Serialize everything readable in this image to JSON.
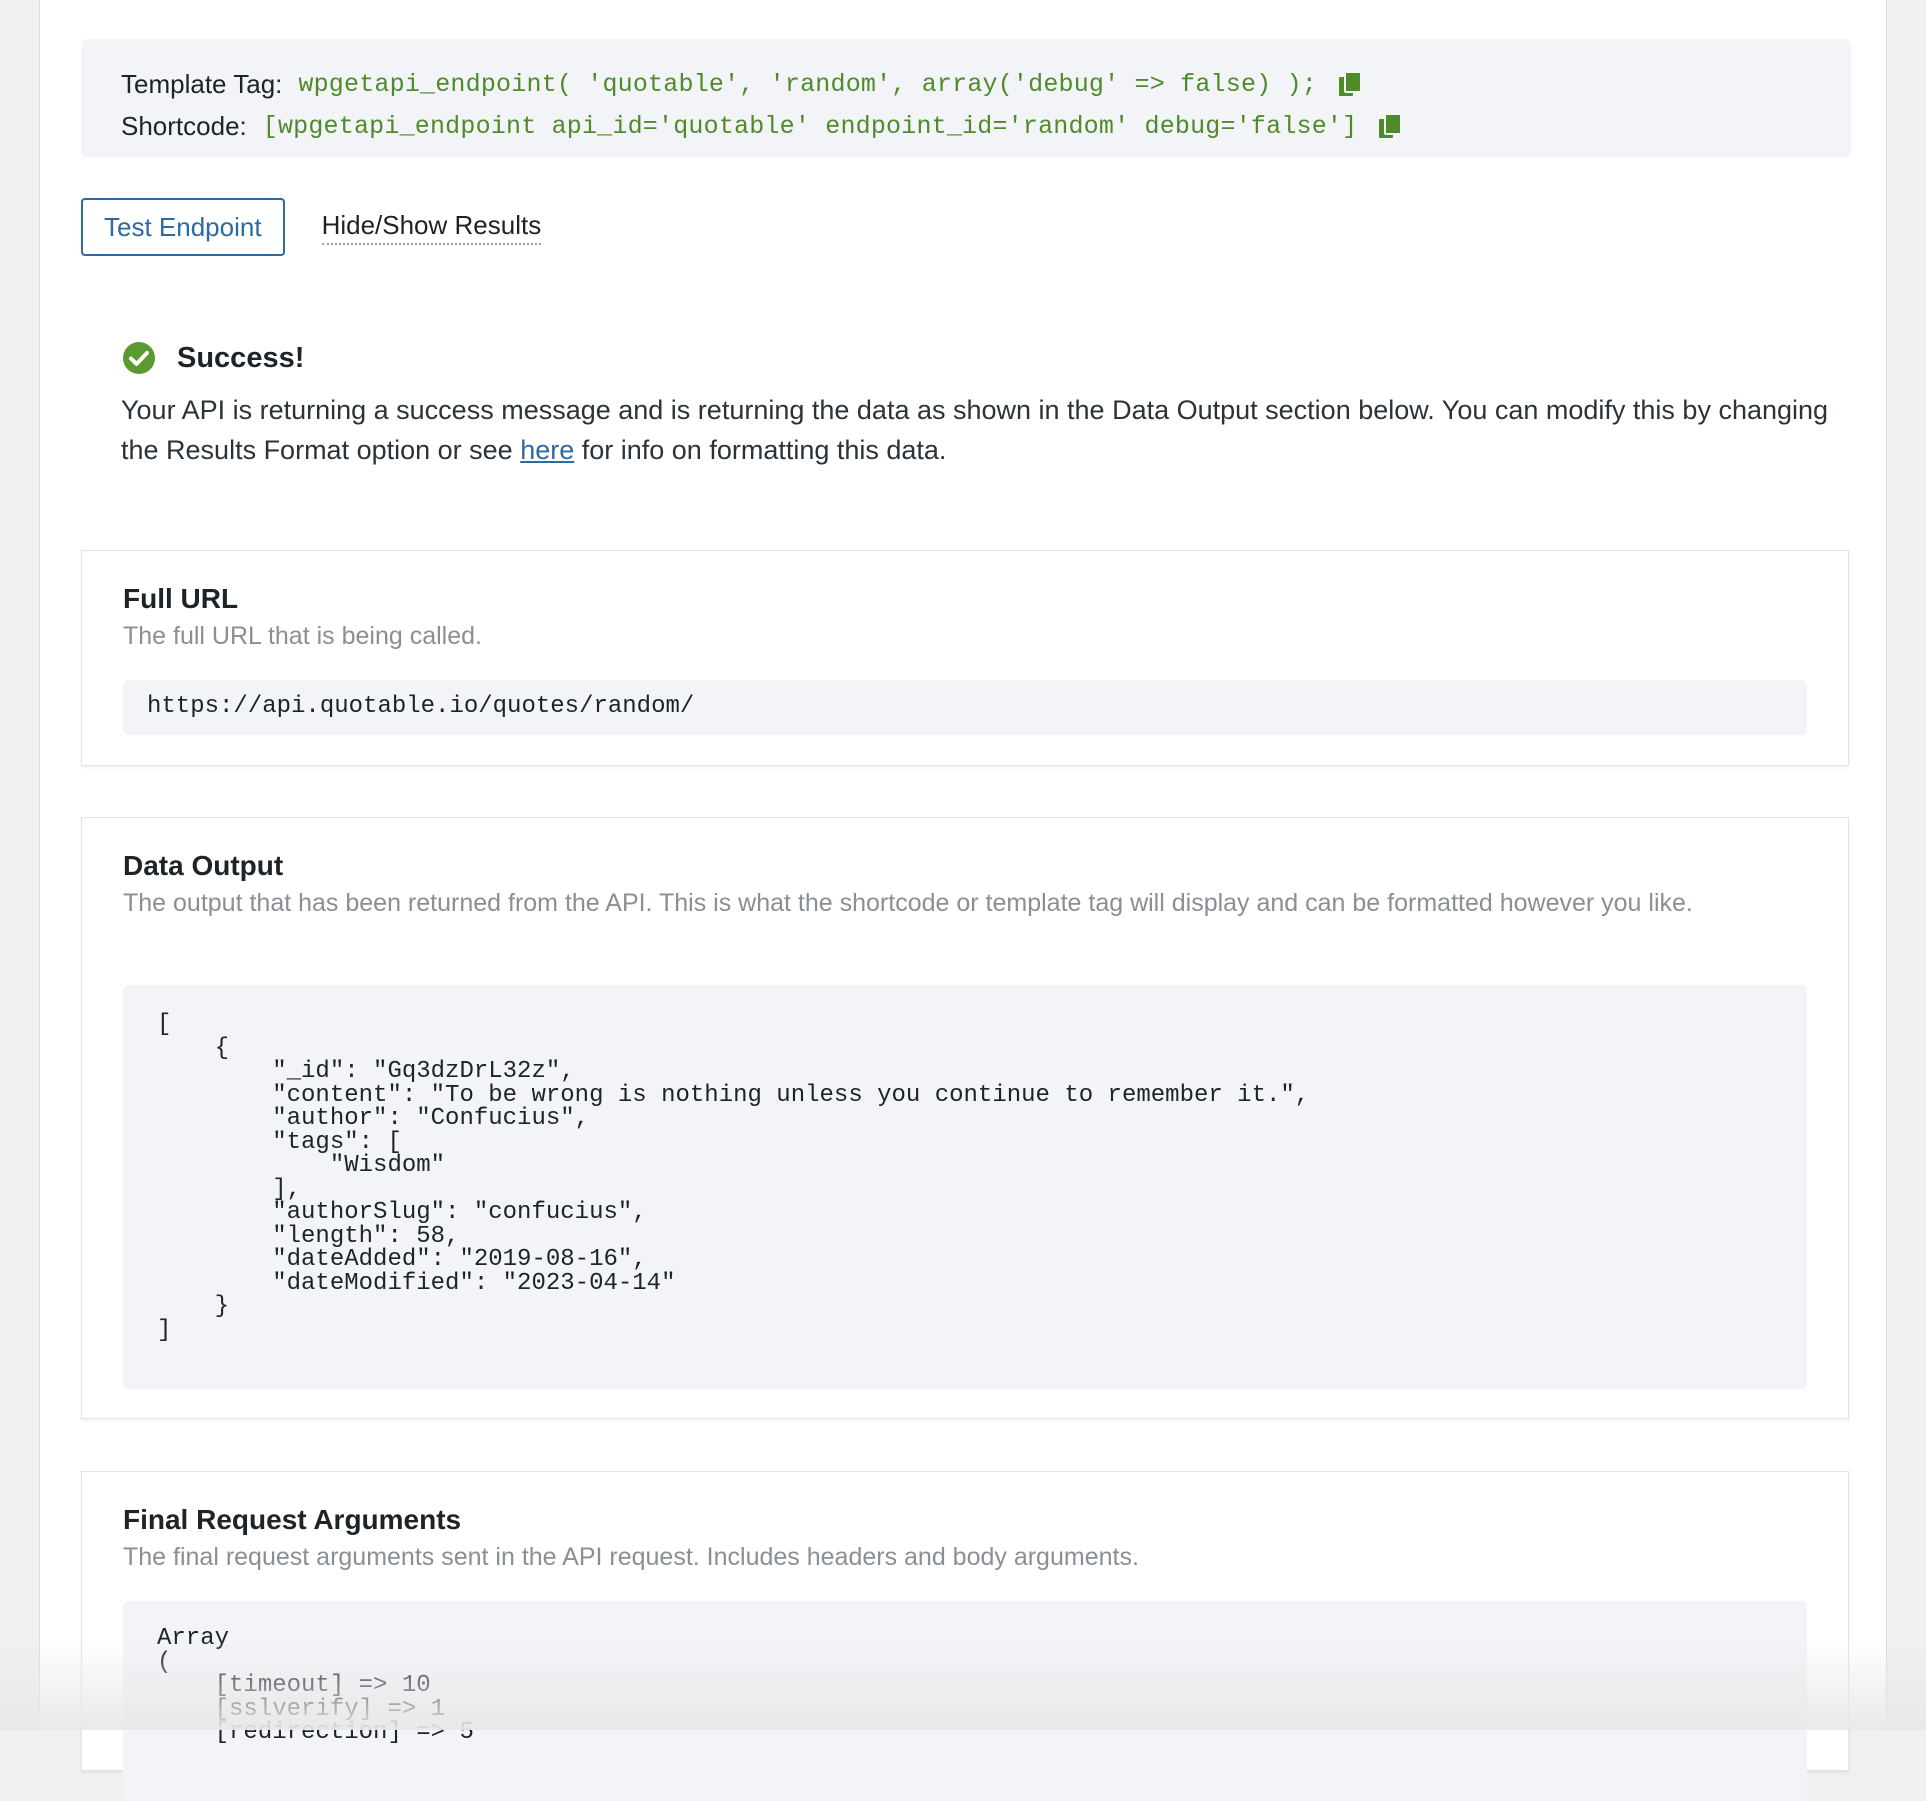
{
  "template_tag": {
    "label": "Template Tag:",
    "code": "wpgetapi_endpoint( 'quotable', 'random', array('debug' => false) );",
    "copy_icon": "copy-icon"
  },
  "shortcode": {
    "label": "Shortcode:",
    "code": "[wpgetapi_endpoint api_id='quotable' endpoint_id='random' debug='false']",
    "copy_icon": "copy-icon"
  },
  "actions": {
    "test_label": "Test Endpoint",
    "toggle_label": "Hide/Show Results"
  },
  "success": {
    "icon": "check-circle-icon",
    "title": "Success!",
    "text_before": "Your API is returning a success message and is returning the data as shown in the Data Output section below. You can modify this by changing the Results Format option or see ",
    "link_text": "here",
    "text_after": " for info on formatting this data."
  },
  "full_url": {
    "title": "Full URL",
    "description": "The full URL that is being called.",
    "value": "https://api.quotable.io/quotes/random/"
  },
  "data_output": {
    "title": "Data Output",
    "description": "The output that has been returned from the API. This is what the shortcode or template tag will display and can be formatted however you like.",
    "code": "[\n    {\n        \"_id\": \"Gq3dzDrL32z\",\n        \"content\": \"To be wrong is nothing unless you continue to remember it.\",\n        \"author\": \"Confucius\",\n        \"tags\": [\n            \"Wisdom\"\n        ],\n        \"authorSlug\": \"confucius\",\n        \"length\": 58,\n        \"dateAdded\": \"2019-08-16\",\n        \"dateModified\": \"2023-04-14\"\n    }\n]"
  },
  "final_request": {
    "title": "Final Request Arguments",
    "description": "The final request arguments sent in the API request. Includes headers and body arguments.",
    "code": "Array\n(\n    [timeout] => 10\n    [sslverify] => 1\n    [redirection] => 5"
  },
  "colors": {
    "accent": "#2d6aa0",
    "code_green": "#4f8a2b",
    "success_green": "#5a9a2e"
  }
}
